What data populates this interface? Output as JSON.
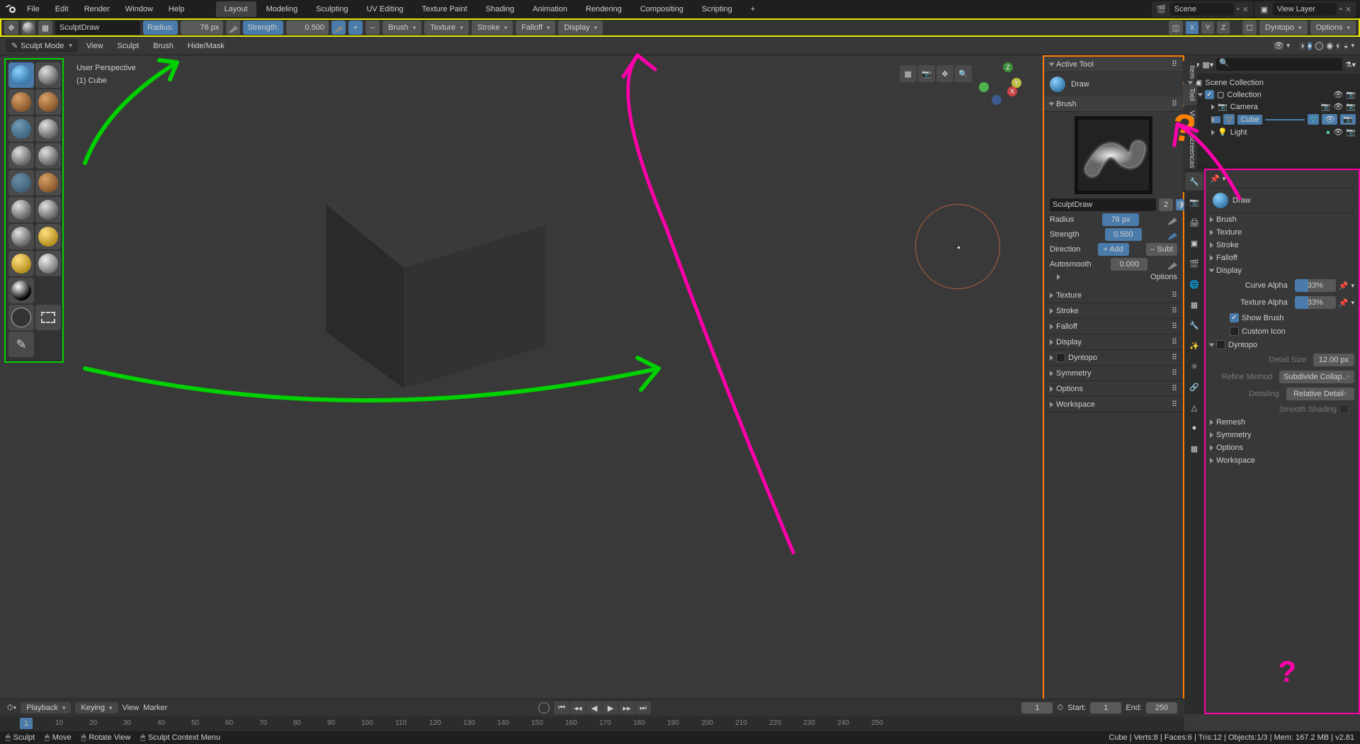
{
  "topbar": {
    "menus": [
      "File",
      "Edit",
      "Render",
      "Window",
      "Help"
    ],
    "workspaces": [
      "Layout",
      "Modeling",
      "Sculpting",
      "UV Editing",
      "Texture Paint",
      "Shading",
      "Animation",
      "Rendering",
      "Compositing",
      "Scripting"
    ],
    "scene_label": "Scene",
    "viewlayer_label": "View Layer"
  },
  "toolheader": {
    "brush_name": "SculptDraw",
    "radius_label": "Radius:",
    "radius_value": "76 px",
    "strength_label": "Strength:",
    "strength_value": "0.500",
    "btns": [
      "Brush",
      "Texture",
      "Stroke",
      "Falloff",
      "Display"
    ],
    "axes": [
      "X",
      "Y",
      "Z"
    ],
    "dyntopo": "Dyntopo",
    "options": "Options"
  },
  "modeheader": {
    "mode": "Sculpt Mode",
    "menus": [
      "View",
      "Sculpt",
      "Brush",
      "Hide/Mask"
    ]
  },
  "overlay": {
    "persp": "User Perspective",
    "obj": "(1) Cube"
  },
  "npanel": {
    "active_tool_h": "Active Tool",
    "draw": "Draw",
    "brush_h": "Brush",
    "brush_name": "SculptDraw",
    "brush_users": "2",
    "radius_lbl": "Radius",
    "radius_val": "76 px",
    "strength_lbl": "Strength",
    "strength_val": "0.500",
    "direction_lbl": "Direction",
    "add": "+ Add",
    "subt": "– Subt",
    "autosmooth_lbl": "Autosmooth",
    "autosmooth_val": "0.000",
    "options_sub": "Options",
    "sections": [
      "Texture",
      "Stroke",
      "Falloff",
      "Display",
      "Dyntopo",
      "Symmetry",
      "Options",
      "Workspace"
    ],
    "vtabs": [
      "Item",
      "Tool",
      "View",
      "Screencast Keys"
    ]
  },
  "outliner": {
    "root": "Scene Collection",
    "collection": "Collection",
    "items": [
      "Camera",
      "Cube",
      "Light"
    ]
  },
  "props": {
    "draw": "Draw",
    "sections_top": [
      "Brush",
      "Texture",
      "Stroke",
      "Falloff"
    ],
    "display": "Display",
    "curve_alpha_lbl": "Curve Alpha",
    "curve_alpha_val": "33%",
    "texture_alpha_lbl": "Texture Alpha",
    "texture_alpha_val": "33%",
    "show_brush": "Show Brush",
    "custom_icon": "Custom Icon",
    "dyntopo": "Dyntopo",
    "detail_size_lbl": "Detail Size",
    "detail_size_val": "12.00 px",
    "refine_lbl": "Refine Method",
    "refine_val": "Subdivide Collap..",
    "detailing_lbl": "Detailing",
    "detailing_val": "Relative Detail",
    "smooth_shading": "Smooth Shading",
    "sections_bot": [
      "Remesh",
      "Symmetry",
      "Options",
      "Workspace"
    ]
  },
  "timeline": {
    "playback": "Playback",
    "keying": "Keying",
    "view": "View",
    "marker": "Marker",
    "cur_frame": "1",
    "start_lbl": "Start:",
    "start_val": "1",
    "end_lbl": "End:",
    "end_val": "250",
    "ticks": [
      1,
      10,
      20,
      30,
      40,
      50,
      60,
      70,
      80,
      90,
      100,
      110,
      120,
      130,
      140,
      150,
      160,
      170,
      180,
      190,
      200,
      210,
      220,
      230,
      240,
      250
    ]
  },
  "status": {
    "sculpt": "Sculpt",
    "move": "Move",
    "rotate": "Rotate View",
    "menu": "Sculpt Context Menu",
    "right": "Cube | Verts:8 | Faces:6 | Tris:12 | Objects:1/3 | Mem: 167.2 MB | v2.81"
  }
}
